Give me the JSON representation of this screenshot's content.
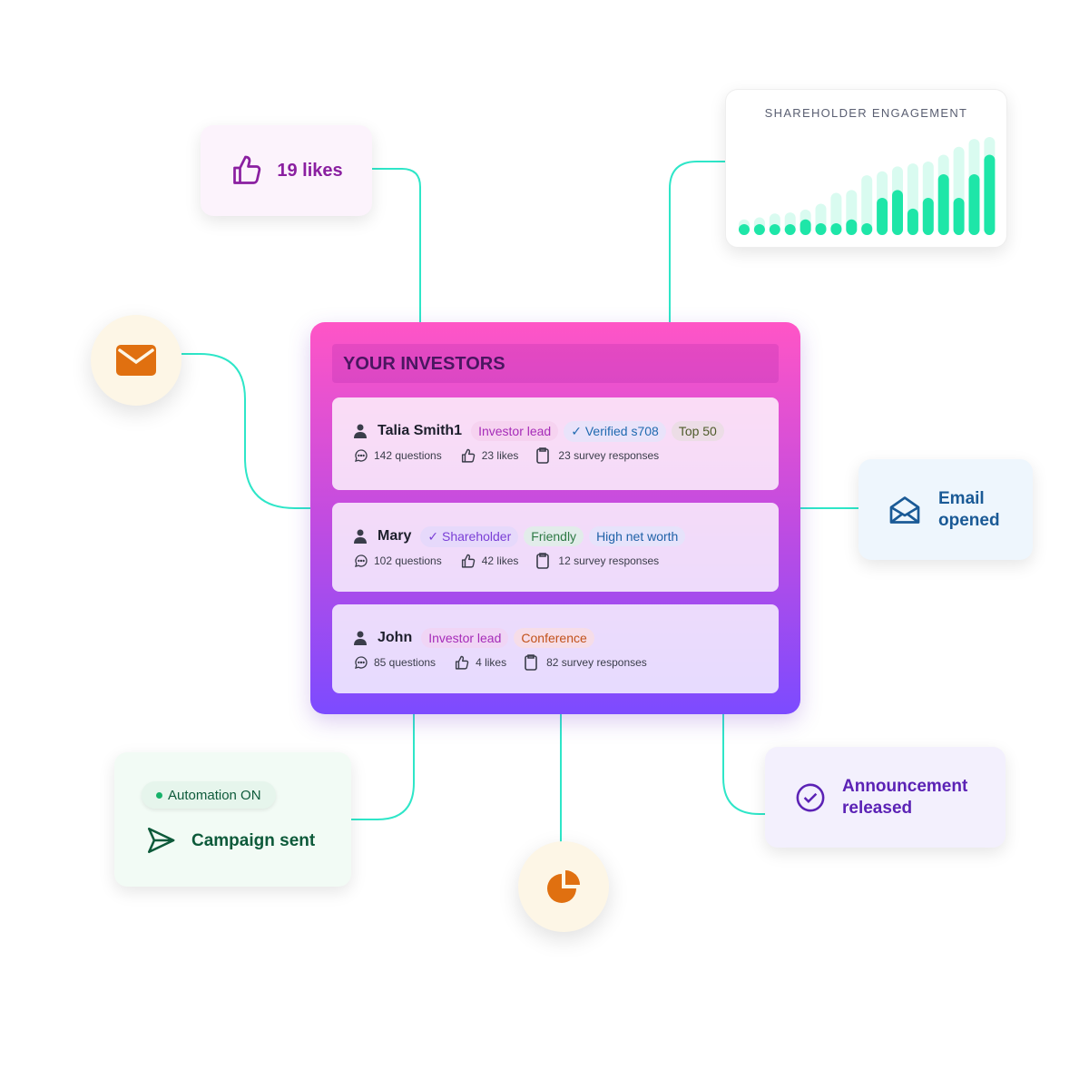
{
  "likes_card": {
    "label": "19 likes",
    "icon": "thumbs-up-icon",
    "color": "#8a1fa0"
  },
  "engagement": {
    "title": "SHAREHOLDER ENGAGEMENT",
    "chart_data": {
      "type": "bar",
      "title": "SHAREHOLDER ENGAGEMENT",
      "series": [
        {
          "values": [
            16,
            18,
            22,
            23,
            26,
            32,
            43,
            46,
            61,
            65,
            70,
            73,
            75,
            82,
            90,
            98,
            100
          ]
        },
        {
          "values": [
            5,
            5,
            9,
            9,
            16,
            12,
            12,
            16,
            12,
            38,
            46,
            27,
            38,
            62,
            38,
            62,
            82
          ]
        }
      ],
      "colors": [
        "#d9fbf0",
        "#1ee6a8"
      ],
      "grid": false
    }
  },
  "mail_bubble": {
    "icon": "envelope-icon",
    "color": "#e07010"
  },
  "investors": {
    "title": "YOUR INVESTORS",
    "rows": [
      {
        "name": "Talia Smith1",
        "tags": [
          {
            "label": "Investor lead",
            "fg": "#a62cb8",
            "bg": "#f6d3f0"
          },
          {
            "label": "✓ Verified s708",
            "fg": "#1f6ab0",
            "bg": "#e9e3fa"
          },
          {
            "label": "Top 50",
            "fg": "#4e5a2a",
            "bg": "#ecdde6"
          }
        ],
        "questions": "142 questions",
        "likes": "23 likes",
        "surveys": "23 survey responses"
      },
      {
        "name": "Mary",
        "tags": [
          {
            "label": "✓ Shareholder",
            "fg": "#7a3fd6",
            "bg": "#e6d9fb"
          },
          {
            "label": "Friendly",
            "fg": "#2e7a45",
            "bg": "#e2ecea"
          },
          {
            "label": "High net worth",
            "fg": "#2062a8",
            "bg": "#e6e3fb"
          }
        ],
        "questions": "102 questions",
        "likes": "42 likes",
        "surveys": "12 survey responses"
      },
      {
        "name": "John",
        "tags": [
          {
            "label": "Investor lead",
            "fg": "#a62cb8",
            "bg": "#f0d5f5"
          },
          {
            "label": "Conference",
            "fg": "#c2521a",
            "bg": "#f6dde8"
          }
        ],
        "questions": "85 questions",
        "likes": "4 likes",
        "surveys": "82 survey responses"
      }
    ]
  },
  "email_card": {
    "label_line1": "Email",
    "label_line2": "opened",
    "icon": "envelope-open-icon",
    "color": "#1a5a96"
  },
  "campaign_card": {
    "badge": "Automation ON",
    "label": "Campaign sent",
    "icon": "send-icon",
    "color": "#0d5a3a"
  },
  "pie_bubble": {
    "icon": "pie-chart-icon",
    "color": "#e07010"
  },
  "announcement_card": {
    "label_line1": "Announcement",
    "label_line2": "released",
    "icon": "check-circle-icon",
    "color": "#5b22b5"
  },
  "connector_color": "#2ee6c8"
}
